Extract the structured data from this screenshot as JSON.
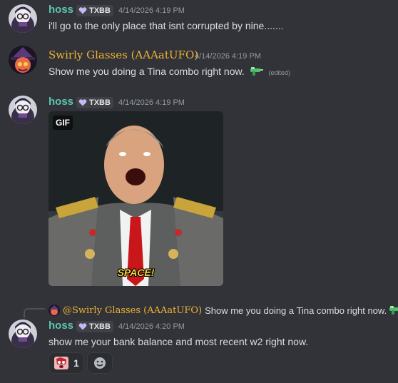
{
  "messages": [
    {
      "author": "hoss",
      "author_color": "#5ec4b0",
      "tag": "TXBB",
      "timestamp": "4/14/2026 4:19 PM",
      "text": "i'll go to the only place that isnt corrupted by nine......."
    },
    {
      "author": "Swirly Glasses (AAAatUFO)",
      "author_color": "#f0b232",
      "timestamp": "4/14/2026 4:19 PM",
      "text": "Show me you doing a Tina combo right now.",
      "edited_label": "(edited)",
      "emoji": "water-gun-icon"
    },
    {
      "author": "hoss",
      "author_color": "#5ec4b0",
      "tag": "TXBB",
      "timestamp": "4/14/2026 4:19 PM",
      "gif": {
        "badge": "GIF",
        "caption": "SPACE!"
      }
    },
    {
      "reply_to": {
        "author": "@Swirly Glasses (AAAatUFO)",
        "text": "Show me you doing a Tina combo right now."
      },
      "author": "hoss",
      "author_color": "#5ec4b0",
      "tag": "TXBB",
      "timestamp": "4/14/2026 4:20 PM",
      "text": "show me your bank balance and most recent w2 right now.",
      "reactions": [
        {
          "emoji": "panicked-face-emoji-icon",
          "count": "1"
        },
        {
          "emoji": "add-reaction-icon"
        }
      ]
    }
  ]
}
